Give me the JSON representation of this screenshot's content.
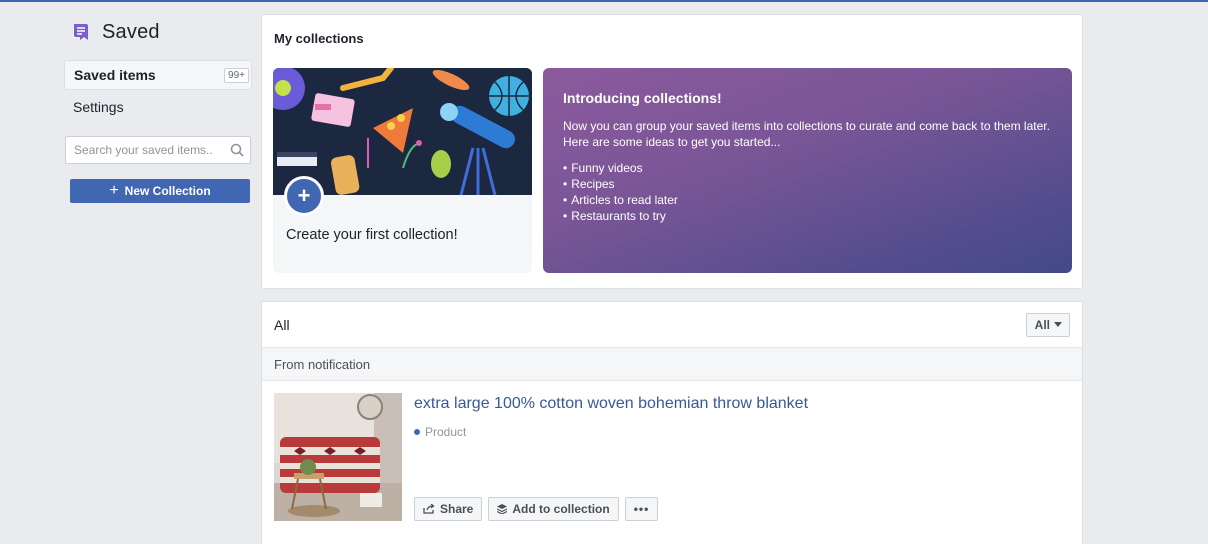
{
  "sidebar": {
    "title": "Saved",
    "items": [
      {
        "label": "Saved items",
        "badge": "99+"
      },
      {
        "label": "Settings"
      }
    ],
    "search_placeholder": "Search your saved items..",
    "new_collection_label": "New Collection"
  },
  "collections": {
    "header": "My collections",
    "create_label": "Create your first collection!",
    "intro": {
      "title": "Introducing collections!",
      "body": "Now you can group your saved items into collections to curate and come back to them later. Here are some ideas to get you started...",
      "ideas": [
        "Funny videos",
        "Recipes",
        "Articles to read later",
        "Restaurants to try"
      ]
    }
  },
  "all": {
    "title": "All",
    "filter_value": "All",
    "section_label": "From notification",
    "items": [
      {
        "title": "extra large 100% cotton woven bohemian throw blanket",
        "type": "Product",
        "actions": {
          "share": "Share",
          "add": "Add to collection",
          "more": "•••"
        }
      }
    ]
  },
  "colors": {
    "accent": "#4267b2",
    "link": "#385898",
    "background": "#e9ebee"
  },
  "icons": [
    "saved-ribbon-icon",
    "search-icon",
    "plus-icon",
    "share-icon",
    "collection-icon",
    "caret-down-icon"
  ]
}
